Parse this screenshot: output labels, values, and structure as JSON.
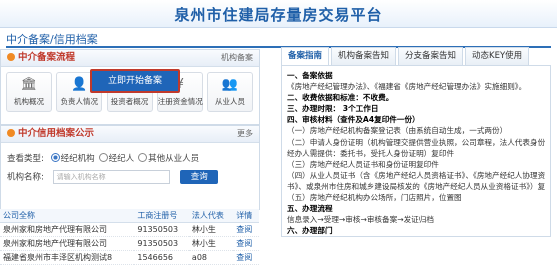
{
  "site_title": "泉州市住建局存量房交易平台",
  "breadcrumb": "中介备案/信用档案",
  "process_panel": {
    "title": "中介备案流程",
    "more": "机构备案"
  },
  "process_icons": [
    {
      "icon": "bank-icon",
      "glyph": "🏛",
      "label": "机构概况"
    },
    {
      "icon": "person-icon",
      "glyph": "👤",
      "label": "负责人情况"
    },
    {
      "icon": "people-icon",
      "glyph": "👥",
      "label": "投资者概况"
    },
    {
      "icon": "money-icon",
      "glyph": "¥",
      "label": "注册资金情况"
    },
    {
      "icon": "staff-icon",
      "glyph": "👥",
      "label": "从业人员"
    }
  ],
  "start_button": "立即开始备案",
  "credit_panel": {
    "title": "中介信用档案公示",
    "more": "更多"
  },
  "query": {
    "type_label": "查看类型:",
    "options": [
      "经纪机构",
      "经纪人",
      "其他从业人员"
    ],
    "selected": 0,
    "name_label": "机构名称:",
    "placeholder": "请输入机构名称",
    "button": "查询"
  },
  "table": {
    "headers": [
      "公司全称",
      "工商注册号",
      "法人代表",
      "详情"
    ],
    "rows": [
      [
        "泉州家和房地产代理有限公司",
        "91350503",
        "林小生",
        "查阅"
      ],
      [
        "泉州家和房地产代理有限公司",
        "91350503",
        "林小生",
        "查阅"
      ],
      [
        "福建省泉州市丰泽区机构测试8",
        "1546656",
        "a08",
        "查阅"
      ]
    ]
  },
  "tabs": [
    "备案指南",
    "机构备案告知",
    "分支备案告知",
    "动态KEY使用"
  ],
  "active_tab": 0,
  "guide_lines": [
    {
      "bold": true,
      "text": "一、备案依据"
    },
    {
      "bold": false,
      "text": "《房地产经纪管理办法》、《福建省《房地产经纪管理办法》实施细则》。"
    },
    {
      "bold": true,
      "text": "二、收费依据和标准：不收费。"
    },
    {
      "bold": true,
      "text": "三、办理时限：  3个工作日"
    },
    {
      "bold": true,
      "text": "四、审核材料（查件及A4复印件一份）"
    },
    {
      "bold": false,
      "text": "（一）房地产经纪机构备案登记表（由系统自动生成，一式两份）"
    },
    {
      "bold": false,
      "text": "（二）申请人身份证明（机构管理交提供营业执照，公司章程，法人代表身份证，委托"
    },
    {
      "bold": false,
      "text": "经办人需提供：委托书，受托人身份证明）复印件"
    },
    {
      "bold": false,
      "text": "（三）房地产经纪人员证书和身份证明复印件"
    },
    {
      "bold": false,
      "text": "（四）从业人员证书（含《房地产经纪人员资格证书》、《房地产经纪人协理资格证"
    },
    {
      "bold": false,
      "text": "书》、或泉州市住房和城乡建设局核发的《房地产经纪人员从业资格证书》）复印件"
    },
    {
      "bold": false,
      "text": "（五）房地产经纪机构办公场所，门店照片，位置图"
    },
    {
      "bold": true,
      "text": "五、办理流程"
    },
    {
      "bold": false,
      "text": "信息录入→受理→审核→审核备案→发证归档"
    },
    {
      "bold": true,
      "text": "六、办理部门"
    },
    {
      "bold": false,
      "text": "泉州市住房和城乡建设局"
    }
  ]
}
